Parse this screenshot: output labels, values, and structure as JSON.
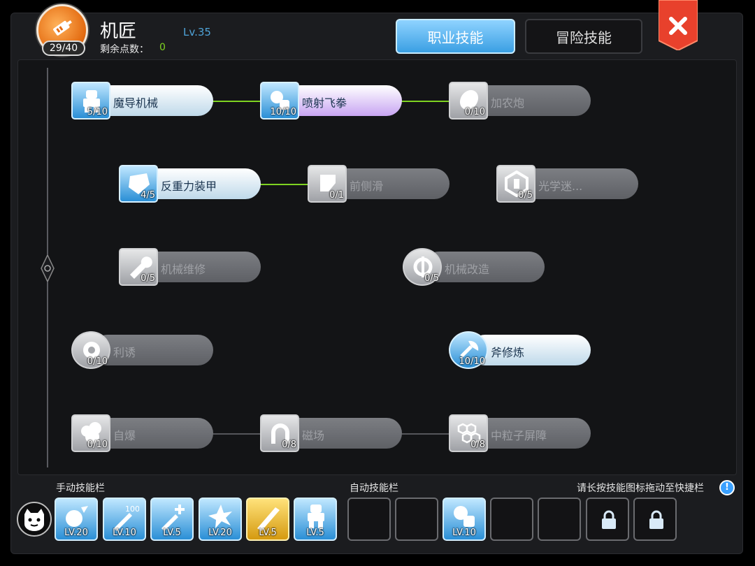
{
  "header": {
    "job_name": "机匠",
    "job_level": "Lv.35",
    "skill_points": "29/40",
    "remaining_label": "剩余点数：",
    "remaining_value": "0"
  },
  "tabs": {
    "job_skills": "职业技能",
    "adventure_skills": "冒险技能"
  },
  "colors": {
    "accent_blue": "#3a9fe3",
    "link_active": "#7ed321",
    "close_red": "#e8412c"
  },
  "skills": [
    {
      "name": "魔导机械",
      "count": "5/10",
      "icon": "mech-robot-icon"
    },
    {
      "name": "喷射飞拳",
      "count": "10/10",
      "icon": "rocket-fist-icon"
    },
    {
      "name": "加农炮",
      "count": "0/10",
      "icon": "cannon-icon"
    },
    {
      "name": "反重力装甲",
      "count": "4/5",
      "icon": "armor-icon"
    },
    {
      "name": "前侧滑",
      "count": "0/1",
      "icon": "slide-icon"
    },
    {
      "name": "光学迷...",
      "count": "0/5",
      "icon": "optical-hexagon-icon"
    },
    {
      "name": "机械维修",
      "count": "0/5",
      "icon": "wrench-icon"
    },
    {
      "name": "机械改造",
      "count": "0/5",
      "icon": "gear-wrench-icon"
    },
    {
      "name": "利诱",
      "count": "0/10",
      "icon": "lure-icon"
    },
    {
      "name": "斧修炼",
      "count": "10/10",
      "icon": "axe-training-icon"
    },
    {
      "name": "自爆",
      "count": "0/10",
      "icon": "explosion-icon"
    },
    {
      "name": "磁场",
      "count": "0/8",
      "icon": "magnet-field-icon"
    },
    {
      "name": "中粒子屏障",
      "count": "0/8",
      "icon": "particle-barrier-icon"
    }
  ],
  "bottom": {
    "manual_bar_label": "手动技能栏",
    "auto_bar_label": "自动技能栏",
    "hint": "请长按技能图标拖动至快捷栏",
    "manual_slots": [
      {
        "lv": "LV.20",
        "icon": "burst-face-icon"
      },
      {
        "lv": "LV.10",
        "icon": "sword-100-icon"
      },
      {
        "lv": "LV.5",
        "icon": "sword-plus-icon"
      },
      {
        "lv": "LV.20",
        "icon": "hammer-burst-icon"
      },
      {
        "lv": "LV.5",
        "icon": "golden-strike-icon"
      },
      {
        "lv": "LV.5",
        "icon": "mech-robot-icon"
      }
    ],
    "auto_slots": [
      {
        "lv": "",
        "icon": ""
      },
      {
        "lv": "",
        "icon": ""
      },
      {
        "lv": "LV.10",
        "icon": "rocket-fist-icon"
      },
      {
        "lv": "",
        "icon": ""
      },
      {
        "lv": "",
        "icon": ""
      },
      {
        "lv": "",
        "icon": "lock-icon"
      },
      {
        "lv": "",
        "icon": "lock-icon"
      }
    ]
  }
}
